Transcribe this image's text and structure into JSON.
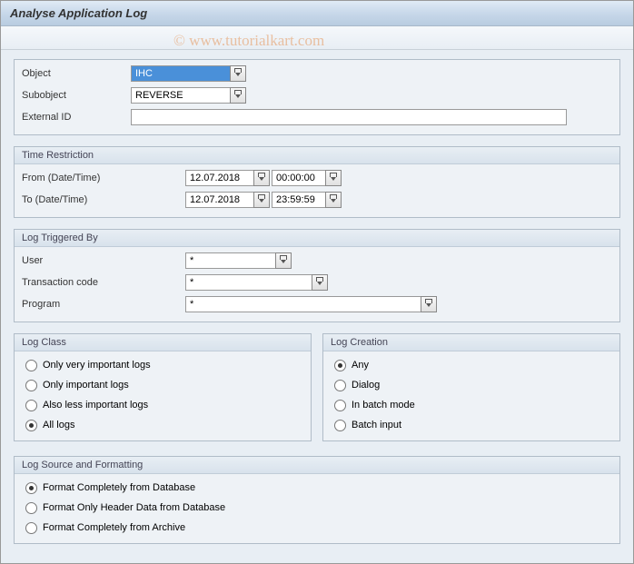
{
  "title": "Analyse Application Log",
  "watermark": "© www.tutorialkart.com",
  "fields": {
    "object_label": "Object",
    "object_value": "IHC",
    "subobject_label": "Subobject",
    "subobject_value": "REVERSE",
    "external_id_label": "External ID",
    "external_id_value": ""
  },
  "time_restriction": {
    "title": "Time Restriction",
    "from_label": "From (Date/Time)",
    "from_date": "12.07.2018",
    "from_time": "00:00:00",
    "to_label": "To (Date/Time)",
    "to_date": "12.07.2018",
    "to_time": "23:59:59"
  },
  "log_triggered": {
    "title": "Log Triggered By",
    "user_label": "User",
    "user_value": "*",
    "tcode_label": "Transaction code",
    "tcode_value": "*",
    "program_label": "Program",
    "program_value": "*"
  },
  "log_class": {
    "title": "Log Class",
    "options": {
      "very_important": "Only very important logs",
      "important": "Only important logs",
      "less_important": "Also less important logs",
      "all": "All logs"
    }
  },
  "log_creation": {
    "title": "Log Creation",
    "options": {
      "any": "Any",
      "dialog": "Dialog",
      "batch": "In batch mode",
      "batch_input": "Batch input"
    }
  },
  "log_source": {
    "title": "Log Source and Formatting",
    "options": {
      "db_full": "Format Completely from Database",
      "db_header": "Format Only Header Data from Database",
      "archive": "Format Completely from Archive"
    }
  }
}
